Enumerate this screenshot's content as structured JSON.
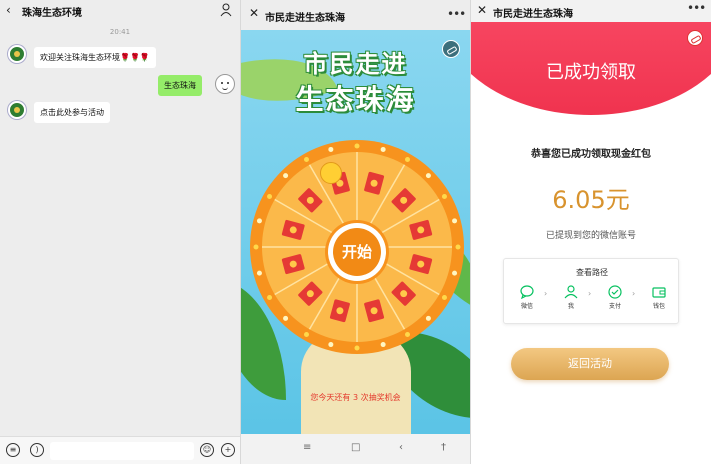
{
  "chat": {
    "title": "珠海生态环境",
    "time": "20:41",
    "welcome": "欢迎关注珠海生态环境🌹🌹🌹",
    "my_message": "生态珠海",
    "reply": "点击此处参与活动"
  },
  "wheel": {
    "title": "市民走进生态珠海",
    "headline_line1": "市民走进",
    "headline_line2": "生态珠海",
    "start_label": "开始",
    "chance_text": "您今天还有 3 次抽奖机会"
  },
  "success": {
    "title": "市民走进生态珠海",
    "banner": "已成功领取",
    "congrats": "恭喜您已成功领取现金红包",
    "amount": "6.05元",
    "withdrawn": "已提现到您的微信账号",
    "path_title": "查看路径",
    "steps": [
      "微信",
      "我",
      "支付",
      "钱包"
    ],
    "return_button": "返回活动"
  },
  "colors": {
    "wheel_orange": "#f7931e",
    "success_red": "#f0334f",
    "amount_gold": "#d8932e",
    "wechat_green": "#07c160"
  }
}
